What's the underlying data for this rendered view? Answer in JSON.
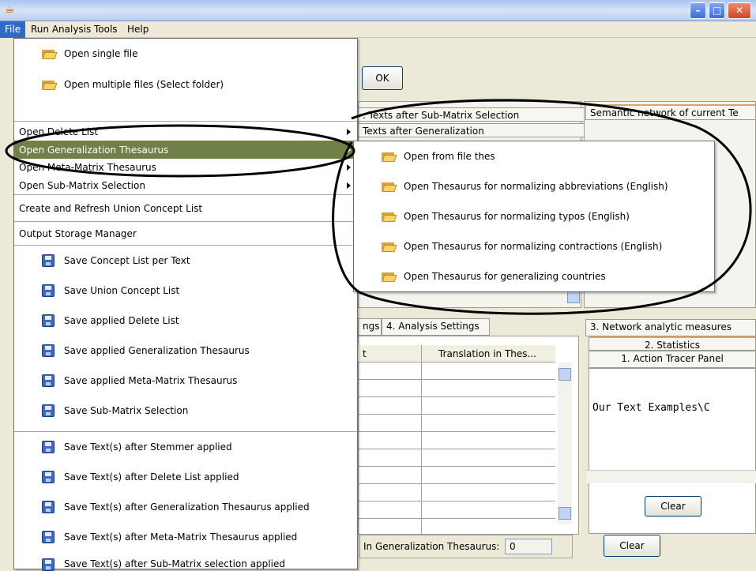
{
  "window": {
    "title": ""
  },
  "menubar": [
    "File",
    "Run Analysis",
    "Tools",
    "Help"
  ],
  "background": {
    "ok_label": "OK",
    "tabs_top": [
      ". Texts after Sub-Matrix Selection",
      "Texts after Generalization"
    ],
    "semantic_tab": "Semantic network of current Te",
    "tabs_mid_left": [
      "ngs",
      "4. Analysis Settings"
    ],
    "table_headers": [
      "t",
      "Translation in Thes..."
    ],
    "tabs_right": [
      "3. Network analytic measures",
      "2. Statistics",
      "1. Action Tracer Panel"
    ],
    "text_area": "Our Text Examples\\C",
    "clear_label": "Clear",
    "clear_label_2": "Clear",
    "gen_thesaurus_label": "In Generalization Thesaurus:",
    "gen_thesaurus_value": "0"
  },
  "file_menu": {
    "open_single": "Open single file",
    "open_multiple": "Open multiple files (Select folder)",
    "open_delete_list": "Open Delete List",
    "open_generalization": "Open Generalization Thesaurus",
    "open_meta_matrix": "Open Meta-Matrix Thesaurus",
    "open_sub_matrix": "Open Sub-Matrix Selection",
    "create_union": "Create and Refresh Union Concept List",
    "output_storage": "Output Storage Manager",
    "save_concept_list": "Save Concept List per Text",
    "save_union": "Save Union Concept List",
    "save_delete": "Save applied Delete List",
    "save_generalization": "Save applied Generalization Thesaurus",
    "save_meta": "Save applied Meta-Matrix Thesaurus",
    "save_sub_matrix": "Save Sub-Matrix Selection",
    "save_stemmer": "Save Text(s) after Stemmer applied",
    "save_after_delete": "Save Text(s) after Delete List applied",
    "save_after_generalization": "Save Text(s) after Generalization Thesaurus applied",
    "save_after_meta": "Save Text(s) after Meta-Matrix Thesaurus applied",
    "save_after_sub_matrix": "Save Text(s) after Sub-Matrix selection applied"
  },
  "submenu": [
    "Open from file thes",
    "Open Thesaurus for normalizing abbreviations (English)",
    "Open Thesaurus for normalizing typos (English)",
    "Open Thesaurus for normalizing contractions (English)",
    "Open Thesaurus for generalizing countries"
  ],
  "colors": {
    "menu_selected": "#6f8048",
    "menubar_active": "#316ac5"
  }
}
